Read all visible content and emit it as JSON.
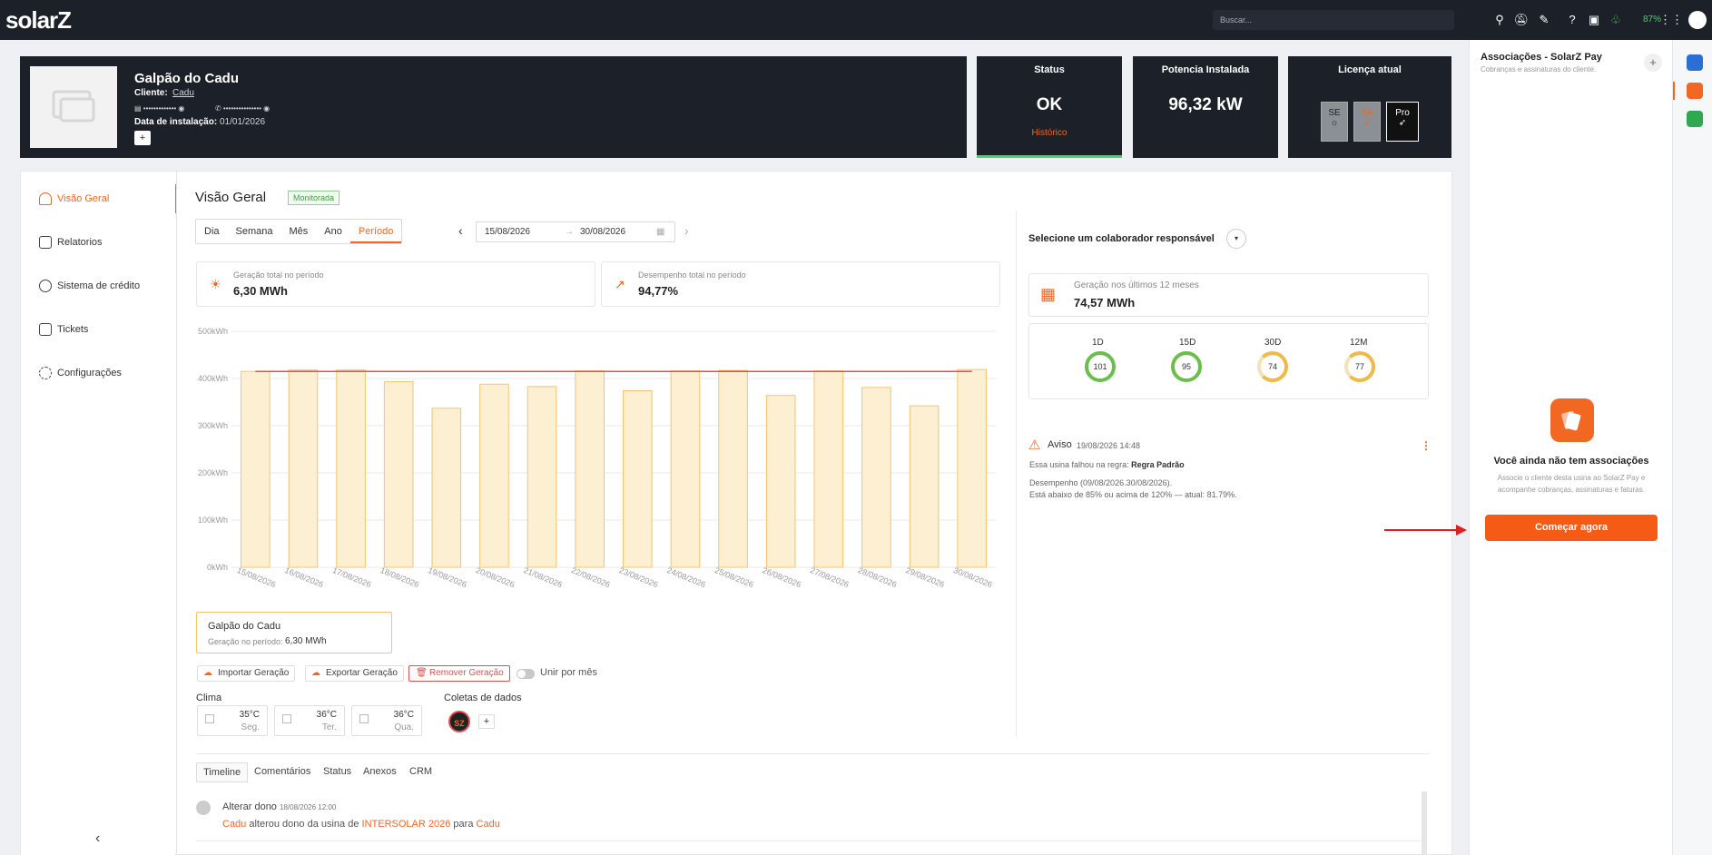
{
  "topbar": {
    "logo": "solarZ",
    "search_placeholder": "Buscar...",
    "battery": "87%",
    "colors": {
      "bg": "#1c2029",
      "accent": "#f26722"
    }
  },
  "header": {
    "plant_name": "Galpão do Cadu",
    "client_label": "Cliente:",
    "client_name": "Cadu",
    "masked1": "▤ ••••••••••••• ◉",
    "masked2": "✆ ••••••••••••••• ◉",
    "install_label": "Data de instalação:",
    "install_date": "01/01/2026",
    "add": "+"
  },
  "status": {
    "title": "Status",
    "value": "OK",
    "link": "Histórico"
  },
  "power": {
    "title": "Potencia Instalada",
    "value": "96,32 kW"
  },
  "license": {
    "title": "Licença atual",
    "badges": [
      "SE",
      "SA",
      "Pro"
    ]
  },
  "nav": {
    "items": [
      "Visão Geral",
      "Relatorios",
      "Sistema de crédito",
      "Tickets",
      "Configurações"
    ]
  },
  "overview": {
    "title": "Visão Geral",
    "badge": "Monitorada"
  },
  "period_tabs": [
    "Dia",
    "Semana",
    "Mês",
    "Ano",
    "Período"
  ],
  "date_range": {
    "start": "15/08/2026",
    "arrow": "→",
    "end": "30/08/2026"
  },
  "kpis": [
    {
      "label": "Geração total no período",
      "value": "6,30 MWh"
    },
    {
      "label": "Desempenho total no período",
      "value": "94,77%"
    }
  ],
  "chart_data": {
    "type": "bar",
    "categories": [
      "15/08/2026",
      "16/08/2026",
      "17/08/2026",
      "18/08/2026",
      "19/08/2026",
      "20/08/2026",
      "21/08/2026",
      "22/08/2026",
      "23/08/2026",
      "24/08/2026",
      "25/08/2026",
      "26/08/2026",
      "27/08/2026",
      "28/08/2026",
      "29/08/2026",
      "30/08/2026"
    ],
    "values": [
      415,
      418,
      418,
      393,
      337,
      388,
      383,
      416,
      374,
      416,
      417,
      364,
      416,
      381,
      342,
      419
    ],
    "reference_line": 415,
    "ylim": [
      0,
      500
    ],
    "yticks": [
      "0kWh",
      "100kWh",
      "200kWh",
      "300kWh",
      "400kWh",
      "500kWh"
    ],
    "grid": true,
    "colors": {
      "bar": "#fdf0d2",
      "bar_stroke": "#f7c46a",
      "reference": "#e0504e"
    }
  },
  "legend_box": {
    "name": "Galpão do Cadu",
    "label": "Geração no período:",
    "value": "6,30 MWh"
  },
  "actions": {
    "import": "Importar Geração",
    "export": "Exportar Geração",
    "remove": "Remover Geração",
    "join": "Unir por mês"
  },
  "clima": {
    "title": "Clima",
    "days": [
      {
        "temp": "35°C",
        "day": "Seg."
      },
      {
        "temp": "36°C",
        "day": "Ter."
      },
      {
        "temp": "36°C",
        "day": "Qua."
      }
    ]
  },
  "coletas": {
    "title": "Coletas de dados",
    "logo": "SZ",
    "add": "+"
  },
  "bottom_tabs": [
    "Timeline",
    "Comentários",
    "Status",
    "Anexos",
    "CRM"
  ],
  "timeline": {
    "title": "Alterar dono",
    "time": "18/08/2026 12:00",
    "user": "Cadu",
    "text1": "alterou dono da usina de",
    "from": "INTERSOLAR 2026",
    "text2": "para",
    "to": "Cadu"
  },
  "right": {
    "collab_label": "Selecione um colaborador responsável",
    "gen12_label": "Geração nos últimos 12 meses",
    "gen12_value": "74,57 MWh",
    "rings": [
      {
        "label": "1D",
        "value": "101"
      },
      {
        "label": "15D",
        "value": "95"
      },
      {
        "label": "30D",
        "value": "74"
      },
      {
        "label": "12M",
        "value": "77"
      }
    ],
    "alert_title": "Aviso",
    "alert_time": "19/08/2026 14:48",
    "alert_rule_text": "Essa usina falhou na regra:",
    "alert_rule": "Regra Padrão",
    "alert_line1": "Desempenho (09/08/2026.30/08/2026).",
    "alert_line2": "Está abaixo de 85% ou acima de 120% — atual: 81.79%."
  },
  "panel": {
    "title": "Associações - SolarZ Pay",
    "subtitle": "Cobranças e assinaturas do cliente.",
    "empty_title": "Você ainda não tem associações",
    "empty_text1": "Associe o cliente desta usina ao SolarZ Pay e",
    "empty_text2": "acompanhe cobranças, assinaturas e faturas.",
    "cta": "Começar agora"
  }
}
